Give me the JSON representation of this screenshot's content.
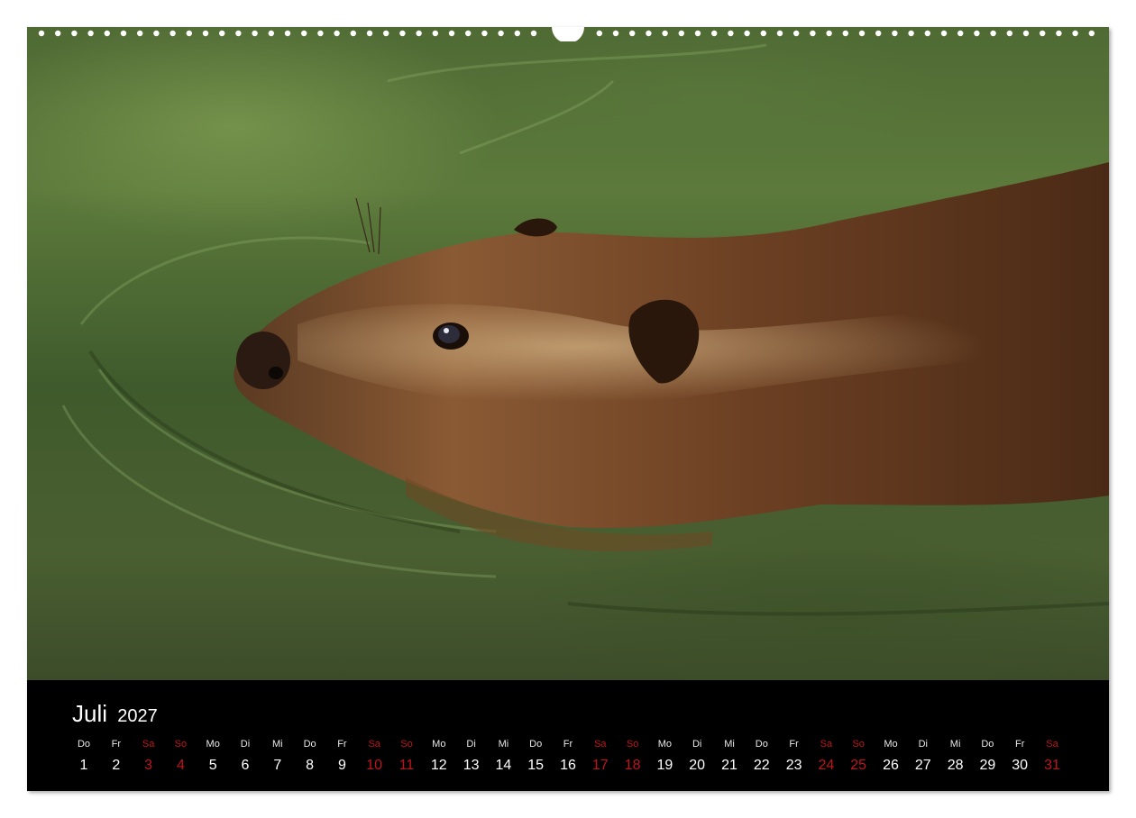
{
  "calendar": {
    "month": "Juli",
    "year": "2027",
    "weekend_color": "#c0141c",
    "days": [
      {
        "wd": "Do",
        "num": "1",
        "weekend": false
      },
      {
        "wd": "Fr",
        "num": "2",
        "weekend": false
      },
      {
        "wd": "Sa",
        "num": "3",
        "weekend": true
      },
      {
        "wd": "So",
        "num": "4",
        "weekend": true
      },
      {
        "wd": "Mo",
        "num": "5",
        "weekend": false
      },
      {
        "wd": "Di",
        "num": "6",
        "weekend": false
      },
      {
        "wd": "Mi",
        "num": "7",
        "weekend": false
      },
      {
        "wd": "Do",
        "num": "8",
        "weekend": false
      },
      {
        "wd": "Fr",
        "num": "9",
        "weekend": false
      },
      {
        "wd": "Sa",
        "num": "10",
        "weekend": true
      },
      {
        "wd": "So",
        "num": "11",
        "weekend": true
      },
      {
        "wd": "Mo",
        "num": "12",
        "weekend": false
      },
      {
        "wd": "Di",
        "num": "13",
        "weekend": false
      },
      {
        "wd": "Mi",
        "num": "14",
        "weekend": false
      },
      {
        "wd": "Do",
        "num": "15",
        "weekend": false
      },
      {
        "wd": "Fr",
        "num": "16",
        "weekend": false
      },
      {
        "wd": "Sa",
        "num": "17",
        "weekend": true
      },
      {
        "wd": "So",
        "num": "18",
        "weekend": true
      },
      {
        "wd": "Mo",
        "num": "19",
        "weekend": false
      },
      {
        "wd": "Di",
        "num": "20",
        "weekend": false
      },
      {
        "wd": "Mi",
        "num": "21",
        "weekend": false
      },
      {
        "wd": "Do",
        "num": "22",
        "weekend": false
      },
      {
        "wd": "Fr",
        "num": "23",
        "weekend": false
      },
      {
        "wd": "Sa",
        "num": "24",
        "weekend": true
      },
      {
        "wd": "So",
        "num": "25",
        "weekend": true
      },
      {
        "wd": "Mo",
        "num": "26",
        "weekend": false
      },
      {
        "wd": "Di",
        "num": "27",
        "weekend": false
      },
      {
        "wd": "Mi",
        "num": "28",
        "weekend": false
      },
      {
        "wd": "Do",
        "num": "29",
        "weekend": false
      },
      {
        "wd": "Fr",
        "num": "30",
        "weekend": false
      },
      {
        "wd": "Sa",
        "num": "31",
        "weekend": true
      }
    ]
  }
}
